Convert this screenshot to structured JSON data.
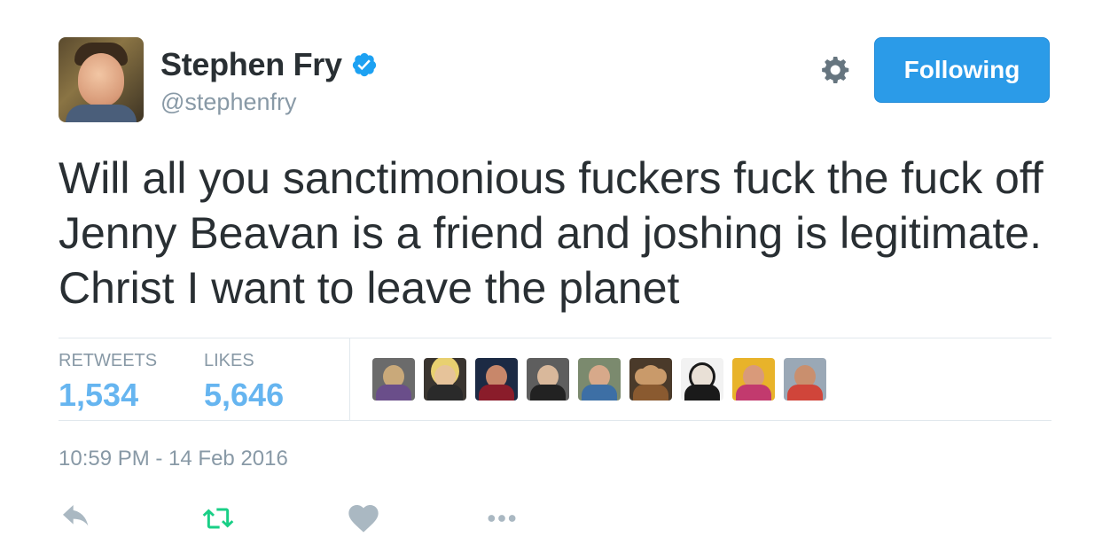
{
  "author": {
    "name": "Stephen Fry",
    "handle": "@stephenfry",
    "verified": true
  },
  "follow_button": {
    "label": "Following",
    "color": "#2b9be8"
  },
  "tweet": {
    "text": "Will all you sanctimonious fuckers fuck the fuck off Jenny Beavan is a friend and joshing is legitimate. Christ I want to leave the planet"
  },
  "stats": {
    "retweets_label": "RETWEETS",
    "retweets_value": "1,534",
    "likes_label": "LIKES",
    "likes_value": "5,646"
  },
  "likers_count_shown": 9,
  "timestamp": "10:59 PM - 14 Feb 2016",
  "actions": [
    "reply-icon",
    "retweet-icon",
    "like-icon",
    "more-icon"
  ],
  "colors": {
    "accent": "#2b9be8",
    "stat_value": "#66b5f0",
    "muted": "#8899a6",
    "retweet_green": "#19cf86",
    "icon_gray": "#aab8c2"
  }
}
